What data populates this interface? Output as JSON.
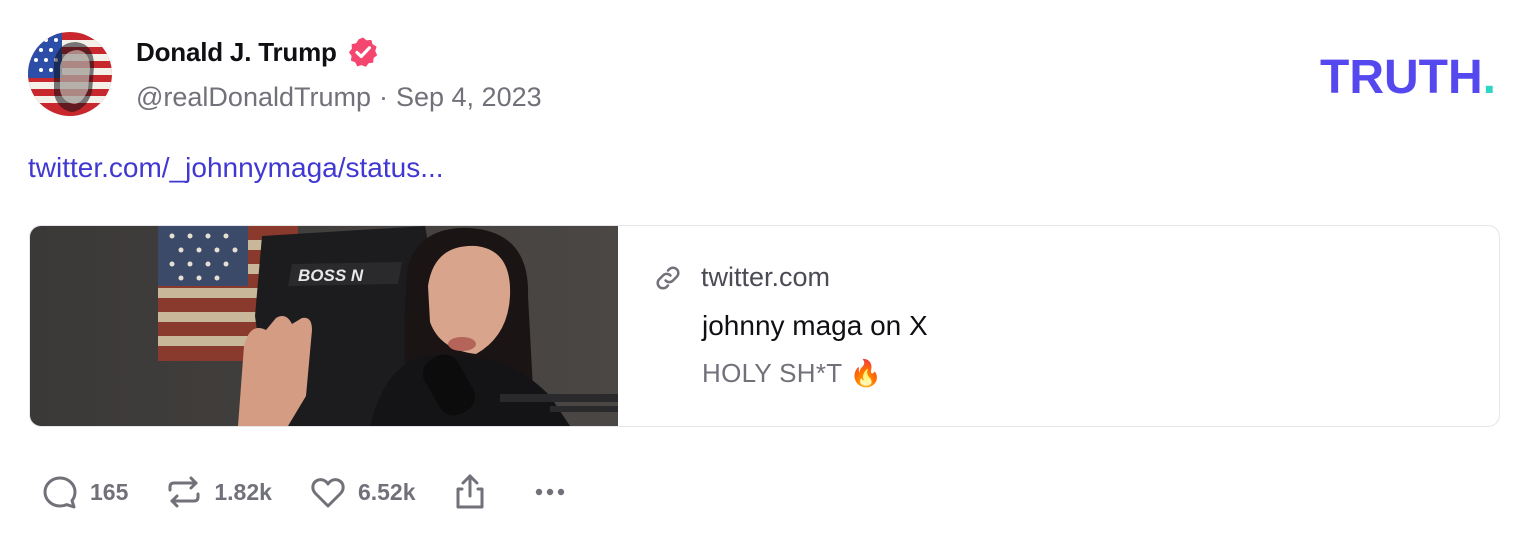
{
  "author": {
    "display_name": "Donald J. Trump",
    "handle": "@realDonaldTrump",
    "separator": "·",
    "date": "Sep 4, 2023",
    "verified": true
  },
  "brand": {
    "logo_text": "TRUTH",
    "logo_dot": ".",
    "logo_color": "#5448ee",
    "dot_color": "#2fd5c5"
  },
  "post": {
    "link_text": "twitter.com/_johnnymaga/status..."
  },
  "card": {
    "domain": "twitter.com",
    "title": "johnny maga on X",
    "description": "HOLY SH*T 🔥",
    "icon": "link-icon"
  },
  "actions": {
    "replies": "165",
    "retruths": "1.82k",
    "likes": "6.52k"
  },
  "colors": {
    "accent": "#4038d1",
    "muted": "#71717a",
    "verified_badge": "#f4466f"
  }
}
